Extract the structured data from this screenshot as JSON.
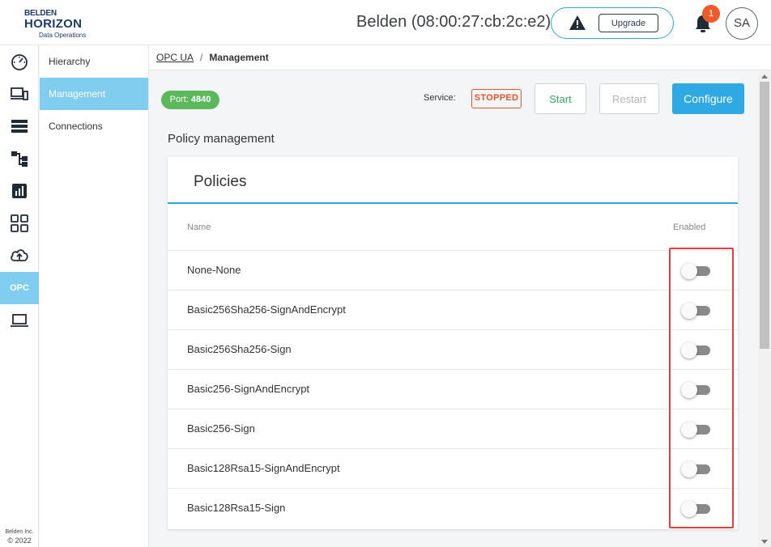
{
  "header": {
    "logo_line1": "BELDEN",
    "logo_line2": "HORIZON",
    "logo_line3": "Data Operations",
    "device_title": "Belden (08:00:27:cb:2c:e2)",
    "upgrade_label": "Upgrade",
    "notification_count": "1",
    "avatar_initials": "SA"
  },
  "rail": {
    "items": [
      {
        "icon": "dashboard-gauge-icon"
      },
      {
        "icon": "devices-icon"
      },
      {
        "icon": "server-list-icon"
      },
      {
        "icon": "hierarchy-tree-icon"
      },
      {
        "icon": "analytics-chart-icon"
      },
      {
        "icon": "apps-grid-icon"
      },
      {
        "icon": "cloud-upload-icon"
      },
      {
        "icon": "opc",
        "label": "OPC",
        "active": true
      },
      {
        "icon": "laptop-icon"
      }
    ],
    "footer_company": "Belden Inc.",
    "footer_year": "© 2022"
  },
  "subnav": {
    "items": [
      {
        "label": "Hierarchy",
        "active": false
      },
      {
        "label": "Management",
        "active": true
      },
      {
        "label": "Connections",
        "active": false
      }
    ]
  },
  "breadcrumb": {
    "link": "OPC UA",
    "separator": "/",
    "current": "Management"
  },
  "toolbar": {
    "port_label": "Port:",
    "port_value": "4840",
    "service_label": "Service:",
    "service_status": "STOPPED",
    "start_label": "Start",
    "restart_label": "Restart",
    "configure_label": "Configure",
    "colors": {
      "port": "#5cb85c",
      "stopped": "#e2542c",
      "configure": "#2ea9e3",
      "accent": "#80cdf0"
    }
  },
  "section_title": "Policy management",
  "policies": {
    "title": "Policies",
    "col_name": "Name",
    "col_enabled": "Enabled",
    "rows": [
      {
        "name": "None-None",
        "enabled": false
      },
      {
        "name": "Basic256Sha256-SignAndEncrypt",
        "enabled": false
      },
      {
        "name": "Basic256Sha256-Sign",
        "enabled": false
      },
      {
        "name": "Basic256-SignAndEncrypt",
        "enabled": false
      },
      {
        "name": "Basic256-Sign",
        "enabled": false
      },
      {
        "name": "Basic128Rsa15-SignAndEncrypt",
        "enabled": false
      },
      {
        "name": "Basic128Rsa15-Sign",
        "enabled": false
      }
    ]
  }
}
